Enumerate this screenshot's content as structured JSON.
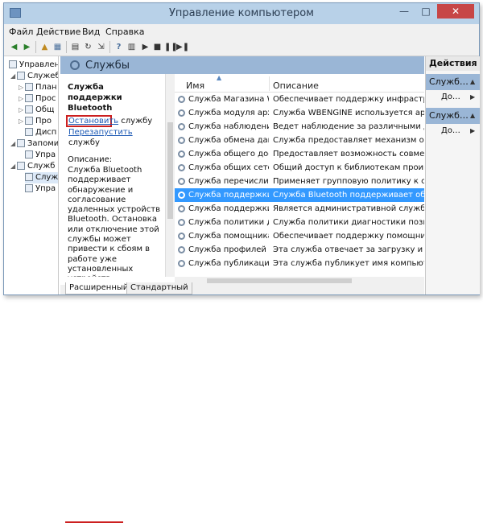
{
  "window": {
    "title": "Управление компьютером",
    "min_glyph": "—",
    "max_glyph": "□",
    "close_glyph": "✕"
  },
  "menu": [
    "Файл",
    "Действие",
    "Вид",
    "Справка"
  ],
  "tree": [
    {
      "label": "Управлен",
      "level": 0
    },
    {
      "label": "Служеб",
      "level": 1
    },
    {
      "label": "План",
      "level": 2
    },
    {
      "label": "Прос",
      "level": 2
    },
    {
      "label": "Общ",
      "level": 2
    },
    {
      "label": "Про",
      "level": 2
    },
    {
      "label": "Дисп",
      "level": 2
    },
    {
      "label": "Запоми",
      "level": 1
    },
    {
      "label": "Упра",
      "level": 2
    },
    {
      "label": "Служб",
      "level": 1
    },
    {
      "label": "Служ",
      "level": 2
    },
    {
      "label": "Упра",
      "level": 2
    }
  ],
  "services_panel": {
    "title": "Службы",
    "selected_name": "Служба поддержки Bluetooth",
    "stop_link": "Остановить",
    "stop_suffix": " службу",
    "restart_link": "Перезапустить",
    "restart_suffix": " службу",
    "description_label": "Описание:",
    "description_text": "Служба Bluetooth поддерживает обнаружение и согласование удаленных устройств Bluetooth. Остановка или отключение этой службы может привести к сбоям в работе уже установленных устройств"
  },
  "table": {
    "columns": [
      "Имя",
      "Описание"
    ],
    "rows": [
      {
        "name": "Служба Магазина Wi",
        "desc": "Обеспечивает поддержку инфраструкту",
        "selected": false
      },
      {
        "name": "Служба модуля архи",
        "desc": "Служба WBENGINE используется архива",
        "selected": false
      },
      {
        "name": "Служба наблюдения…",
        "desc": "Ведет наблюдение за различными датч",
        "selected": false
      },
      {
        "name": "Служба обмена дан…",
        "desc": "Служба предоставляет механизм обмен",
        "selected": false
      },
      {
        "name": "Служба общего дост…",
        "desc": "Предоставляет возможность совместно",
        "selected": false
      },
      {
        "name": "Служба общих сетев…",
        "desc": "Общий доступ к библиотекам проигры",
        "selected": false
      },
      {
        "name": "Служба перечислите…",
        "desc": "Применяет групповую политику к съем",
        "selected": false
      },
      {
        "name": "Служба поддержки B…",
        "desc": "Служба Bluetooth поддерживает обнар",
        "selected": true
      },
      {
        "name": "Служба поддержки ж…",
        "desc": "Является административной службой I",
        "selected": false
      },
      {
        "name": "Служба политики ди…",
        "desc": "Служба политики диагностики позволя",
        "selected": false
      },
      {
        "name": "Служба помощника …",
        "desc": "Обеспечивает поддержку помощника п",
        "selected": false
      },
      {
        "name": "Служба профилей п…",
        "desc": "Эта служба отвечает за загрузку и выг",
        "selected": false
      },
      {
        "name": "Служба публикации …",
        "desc": "Эта служба публикует имя компьютера",
        "selected": false
      }
    ]
  },
  "tabs": {
    "extended": "Расширенный",
    "standard": "Стандартный"
  },
  "actions": {
    "title": "Действия",
    "section1": "Служб…",
    "item1": "До…",
    "section2": "Служб…",
    "item2": "До…"
  },
  "colors": {
    "title_bg": "#b8d1e8",
    "panel_header": "#9ab6d6",
    "selection": "#3399ff",
    "highlight_red": "#cc2020",
    "close_red": "#c74646"
  }
}
